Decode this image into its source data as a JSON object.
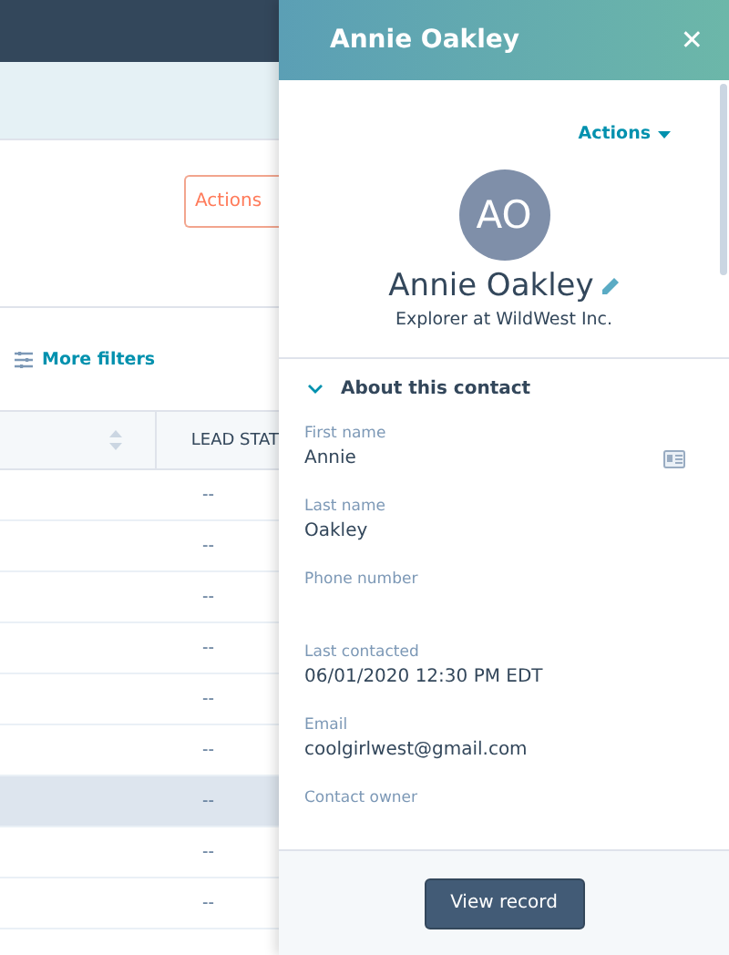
{
  "background": {
    "actions_button": "Actions",
    "more_filters": "More filters",
    "table": {
      "columns": [
        "",
        "LEAD STAT"
      ],
      "rows": [
        {
          "lead_status": "--",
          "highlighted": false
        },
        {
          "lead_status": "--",
          "highlighted": false
        },
        {
          "lead_status": "--",
          "highlighted": false
        },
        {
          "lead_status": "--",
          "highlighted": false
        },
        {
          "lead_status": "--",
          "highlighted": false
        },
        {
          "lead_status": "--",
          "highlighted": false
        },
        {
          "lead_status": "--",
          "highlighted": true
        },
        {
          "lead_status": "--",
          "highlighted": false
        },
        {
          "lead_status": "--",
          "highlighted": false
        }
      ]
    }
  },
  "panel": {
    "title": "Annie Oakley",
    "close": "✕",
    "actions": "Actions",
    "avatar": "AO",
    "name": "Annie Oakley",
    "subtitle": "Explorer at WildWest Inc.",
    "section": {
      "title": "About this contact",
      "expanded": true,
      "fields": [
        {
          "label": "First name",
          "value": "Annie",
          "card_icon": true
        },
        {
          "label": "Last name",
          "value": "Oakley",
          "card_icon": false
        },
        {
          "label": "Phone number",
          "card_icon": false
        },
        {
          "label": "Last contacted",
          "value": "06/01/2020 12:30 PM EDT",
          "card_icon": false
        },
        {
          "label": "Email",
          "value": "coolgirlwest@gmail.com",
          "card_icon": false
        },
        {
          "label": "Contact owner",
          "card_icon": false
        }
      ]
    },
    "button": "View record"
  }
}
